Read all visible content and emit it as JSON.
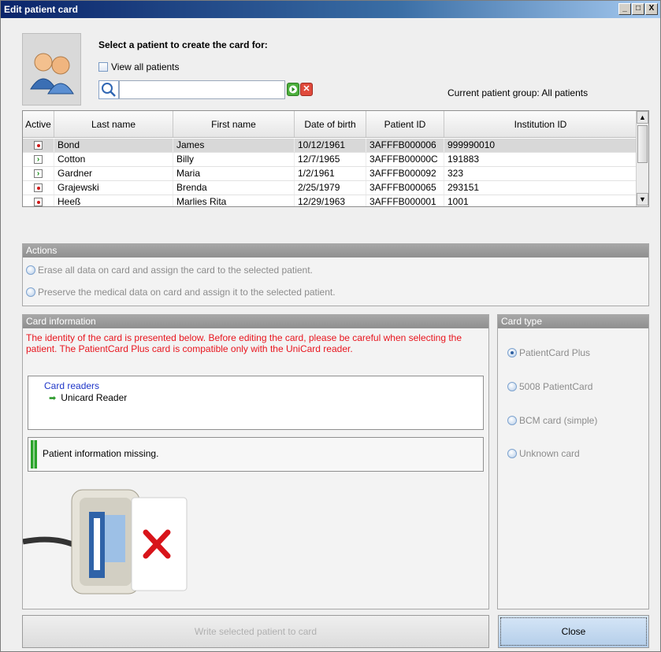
{
  "window": {
    "title": "Edit patient card",
    "minimize": "_",
    "maximize": "□",
    "close": "X"
  },
  "header": {
    "select_title": "Select a patient to create the card for:",
    "view_all_label": "View all patients",
    "search_value": "",
    "group_label": "Current patient group: All patients"
  },
  "table": {
    "columns": [
      "Active",
      "Last name",
      "First name",
      "Date of birth",
      "Patient ID",
      "Institution ID"
    ],
    "rows": [
      {
        "status": "dot",
        "last": "Bond",
        "first": "James",
        "dob": "10/12/1961",
        "pid": "3AFFFB000006",
        "inst": "999990010"
      },
      {
        "status": "arrow",
        "last": "Cotton",
        "first": "Billy",
        "dob": "12/7/1965",
        "pid": "3AFFFB00000C",
        "inst": "191883"
      },
      {
        "status": "arrow",
        "last": "Gardner",
        "first": "Maria",
        "dob": "1/2/1961",
        "pid": "3AFFFB000092",
        "inst": "323"
      },
      {
        "status": "dot",
        "last": "Grajewski",
        "first": "Brenda",
        "dob": "2/25/1979",
        "pid": "3AFFFB000065",
        "inst": "293151"
      },
      {
        "status": "dot",
        "last": "Heeß",
        "first": "Marlies Rita",
        "dob": "12/29/1963",
        "pid": "3AFFFB000001",
        "inst": "1001"
      }
    ]
  },
  "actions": {
    "title": "Actions",
    "options": [
      "Erase all data on card and assign the card to the selected patient.",
      "Preserve the medical data on card and assign it to the selected patient."
    ]
  },
  "card_info": {
    "title": "Card information",
    "warning": "The identity of the card is presented below. Before editing the card, please be careful when selecting the patient. The PatientCard Plus card is compatible only with the UniCard reader.",
    "tree_root": "Card readers",
    "tree_child": "Unicard Reader",
    "status": "Patient information missing."
  },
  "card_type": {
    "title": "Card type",
    "options": [
      "PatientCard Plus",
      "5008 PatientCard",
      "BCM card (simple)",
      "Unknown card"
    ],
    "selected": "PatientCard Plus"
  },
  "buttons": {
    "write": "Write selected patient to card",
    "close": "Close"
  }
}
